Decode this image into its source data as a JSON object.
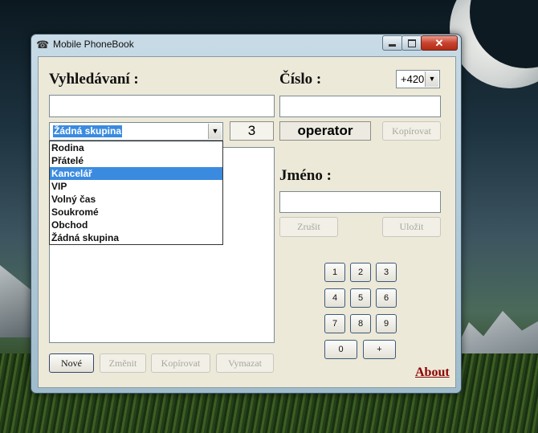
{
  "window": {
    "title": "Mobile PhoneBook",
    "close_glyph": "✕"
  },
  "search": {
    "label": "Vyhledávaní :",
    "value": ""
  },
  "group_select": {
    "selected": "Žádná skupina",
    "count": "3"
  },
  "group_options": [
    "Rodina",
    "Přátelé",
    "Kancelář",
    "VIP",
    "Volný čas",
    "Soukromé",
    "Obchod",
    "Žádná skupina"
  ],
  "group_highlighted_index": 2,
  "number": {
    "label": "Číslo :",
    "value": "",
    "prefix": "+420",
    "operator": "operator",
    "copy_label": "Kopírovat"
  },
  "name": {
    "label": "Jméno :",
    "value": "",
    "cancel_label": "Zrušit",
    "save_label": "Uložit"
  },
  "keypad": [
    "1",
    "2",
    "3",
    "4",
    "5",
    "6",
    "7",
    "8",
    "9",
    "0",
    "+"
  ],
  "bottom_buttons": {
    "new": "Nové",
    "change": "Změnit",
    "copy": "Kopírovat",
    "delete": "Vymazat"
  },
  "about_label": "About",
  "icons": [
    "phonebook-app-icon",
    "minimize-icon",
    "maximize-icon",
    "close-icon",
    "chevron-down-icon"
  ]
}
